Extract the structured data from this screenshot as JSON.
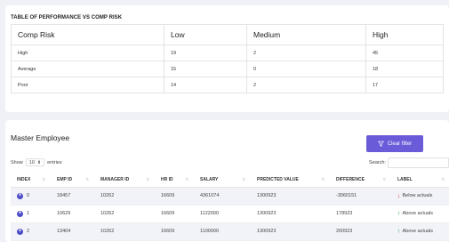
{
  "performance": {
    "title": "TABLE OF PERFORMANCE VS COMP RISK",
    "headers": [
      "Comp Risk",
      "Low",
      "Medium",
      "High"
    ],
    "rows": [
      [
        "High",
        "19",
        "2",
        "45"
      ],
      [
        "Average",
        "15",
        "0",
        "18"
      ],
      [
        "Poor",
        "14",
        "2",
        "17"
      ]
    ]
  },
  "employee": {
    "title": "Master Employee",
    "clear_filter_label": "Clear filter",
    "show_label": "Show",
    "entries_value": "10",
    "entries_label": "entries",
    "search_label": "Search:",
    "search_value": "",
    "columns": [
      "INDEX",
      "EMP ID",
      "MANAGER ID",
      "HR ID",
      "SALARY",
      "PREDICTED VALUE",
      "DIFFERENCE",
      "LABEL"
    ],
    "rows": [
      {
        "index": "0",
        "emp_id": "18457",
        "manager_id": "10262",
        "hr_id": "16609",
        "salary": "4361074",
        "predicted": "1300923",
        "difference": "-3060151",
        "label": "Below actuals",
        "direction": "down"
      },
      {
        "index": "1",
        "emp_id": "10629",
        "manager_id": "10262",
        "hr_id": "16609",
        "salary": "1122000",
        "predicted": "1300923",
        "difference": "178923",
        "label": "Above actuals",
        "direction": "up"
      },
      {
        "index": "2",
        "emp_id": "13404",
        "manager_id": "10262",
        "hr_id": "16609",
        "salary": "1100000",
        "predicted": "1300923",
        "difference": "200923",
        "label": "Above actuals",
        "direction": "up"
      }
    ]
  },
  "colors": {
    "accent": "#6a5cd8",
    "up": "#2e9e4f",
    "down": "#e04343",
    "row_alt": "#f2f3f9"
  }
}
